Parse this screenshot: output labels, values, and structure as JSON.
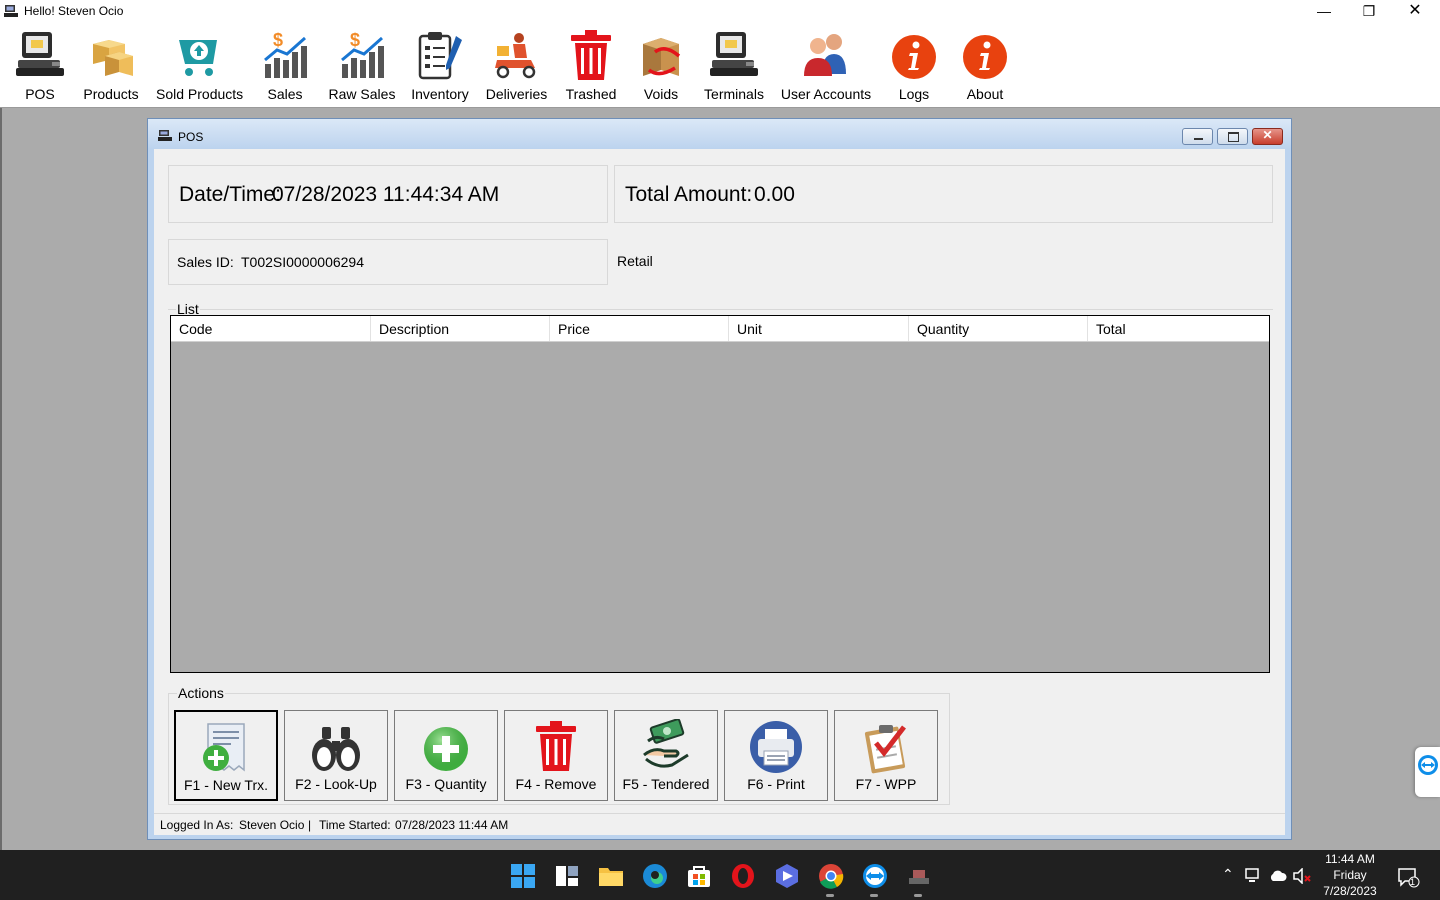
{
  "window": {
    "title": "Hello! Steven Ocio"
  },
  "toolbar": {
    "items": [
      {
        "label": "POS",
        "icon": "pos-terminal-icon"
      },
      {
        "label": "Products",
        "icon": "boxes-icon"
      },
      {
        "label": "Sold Products",
        "icon": "shopping-cart-icon"
      },
      {
        "label": "Sales",
        "icon": "sales-chart-icon"
      },
      {
        "label": "Raw Sales",
        "icon": "raw-sales-chart-icon"
      },
      {
        "label": "Inventory",
        "icon": "clipboard-pen-icon"
      },
      {
        "label": "Deliveries",
        "icon": "delivery-scooter-icon"
      },
      {
        "label": "Trashed",
        "icon": "trash-icon"
      },
      {
        "label": "Voids",
        "icon": "broken-box-icon"
      },
      {
        "label": "Terminals",
        "icon": "terminal-icon"
      },
      {
        "label": "User Accounts",
        "icon": "users-icon"
      },
      {
        "label": "Logs",
        "icon": "info-icon"
      },
      {
        "label": "About",
        "icon": "info-icon"
      }
    ]
  },
  "pos": {
    "title": "POS",
    "datetime_label": "Date/Time:",
    "datetime_value": "07/28/2023 11:44:34 AM",
    "total_label": "Total Amount:",
    "total_value": "0.00",
    "sales_id_label": "Sales ID:",
    "sales_id_value": "T002SI0000006294",
    "mode": "Retail",
    "list": {
      "label": "List",
      "columns": [
        "Code",
        "Description",
        "Price",
        "Unit",
        "Quantity",
        "Total"
      ],
      "rows": []
    },
    "actions": {
      "label": "Actions",
      "buttons": [
        {
          "label": "F1 - New Trx.",
          "icon": "new-receipt-icon"
        },
        {
          "label": "F2 - Look-Up",
          "icon": "binoculars-icon"
        },
        {
          "label": "F3 - Quantity",
          "icon": "plus-circle-icon"
        },
        {
          "label": "F4 - Remove",
          "icon": "trash-icon"
        },
        {
          "label": "F5 - Tendered",
          "icon": "cash-hand-icon"
        },
        {
          "label": "F6 - Print",
          "icon": "printer-icon"
        },
        {
          "label": "F7 - WPP",
          "icon": "checklist-icon"
        }
      ]
    },
    "status": {
      "logged_label": "Logged In As:",
      "logged_user": "Steven Ocio",
      "separator": "|",
      "time_label": "Time Started:",
      "time_value": "07/28/2023 11:44 AM"
    }
  },
  "taskbar": {
    "time": "11:44 AM",
    "day": "Friday",
    "date": "7/28/2023",
    "notification_count": "1"
  },
  "colors": {
    "accent_red": "#e3141b",
    "caption_blue": "#bcd3ee",
    "grid_bg": "#ababab",
    "taskbar": "#202020"
  }
}
